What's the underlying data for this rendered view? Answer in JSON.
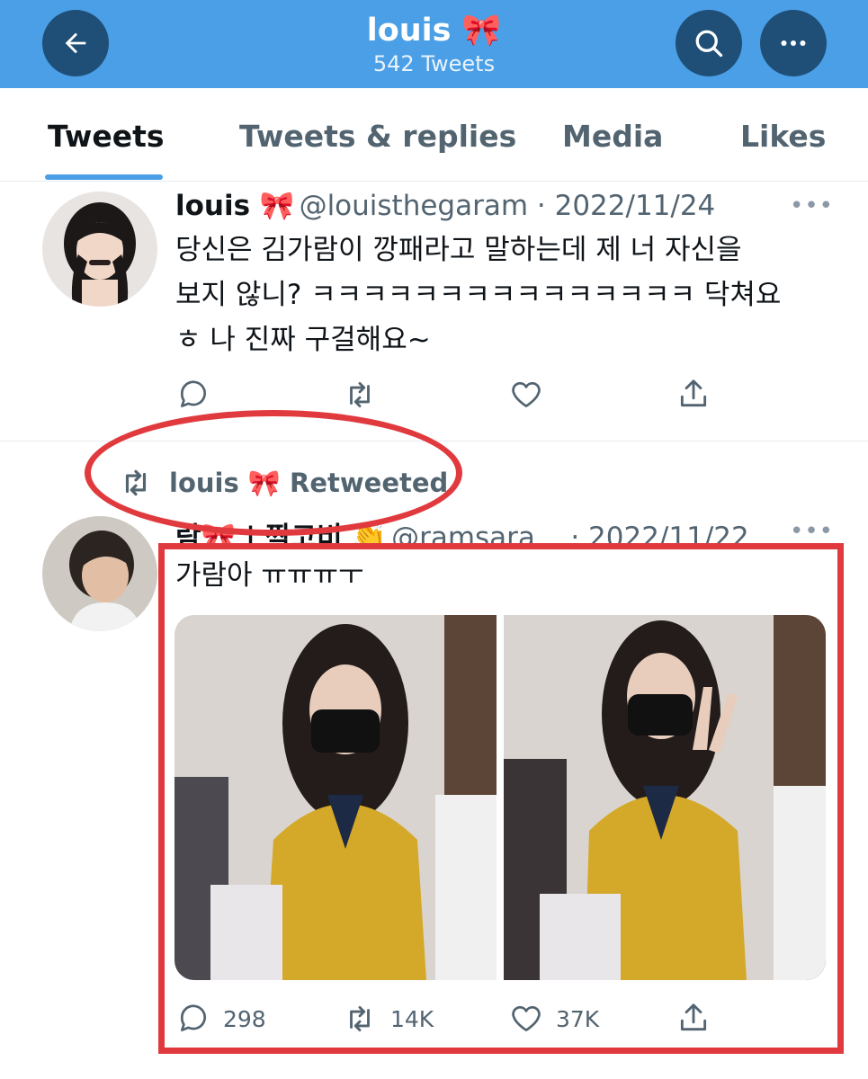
{
  "header": {
    "title": "louis 🎀",
    "subtitle": "542 Tweets",
    "back_icon": "arrow-left-icon",
    "search_icon": "search-icon",
    "more_icon": "more-horizontal-icon",
    "bg_color": "#4a9fe6",
    "button_color": "#1f4f77"
  },
  "tabs": [
    {
      "label": "Tweets",
      "active": true
    },
    {
      "label": "Tweets & replies",
      "active": false
    },
    {
      "label": "Media",
      "active": false
    },
    {
      "label": "Likes",
      "active": false
    }
  ],
  "tweets": [
    {
      "name": "louis 🎀",
      "handle": "@louisthegaram · 2022/11/24",
      "text_lines": [
        "당신은 김가람이 깡패라고 말하는데 제 너 자신을",
        "보지 않니? ㅋㅋㅋㅋㅋㅋㅋㅋㅋㅋㅋㅋㅋㅋㅋ 닥쳐요",
        "ㅎ 나 진짜 구걸해요~"
      ],
      "more": "•••"
    },
    {
      "retweet_label": "louis 🎀 Retweeted",
      "name": "람🎀 | 짝코비 👏",
      "handle": "@ramsara... · 2022/11/22",
      "text_lines": [
        "가람아 ㅠㅠㅠㅜ"
      ],
      "more": "•••",
      "stats": {
        "replies": "298",
        "retweets": "14K",
        "likes": "37K"
      }
    }
  ],
  "annotations": {
    "color": "#e03a3e"
  }
}
